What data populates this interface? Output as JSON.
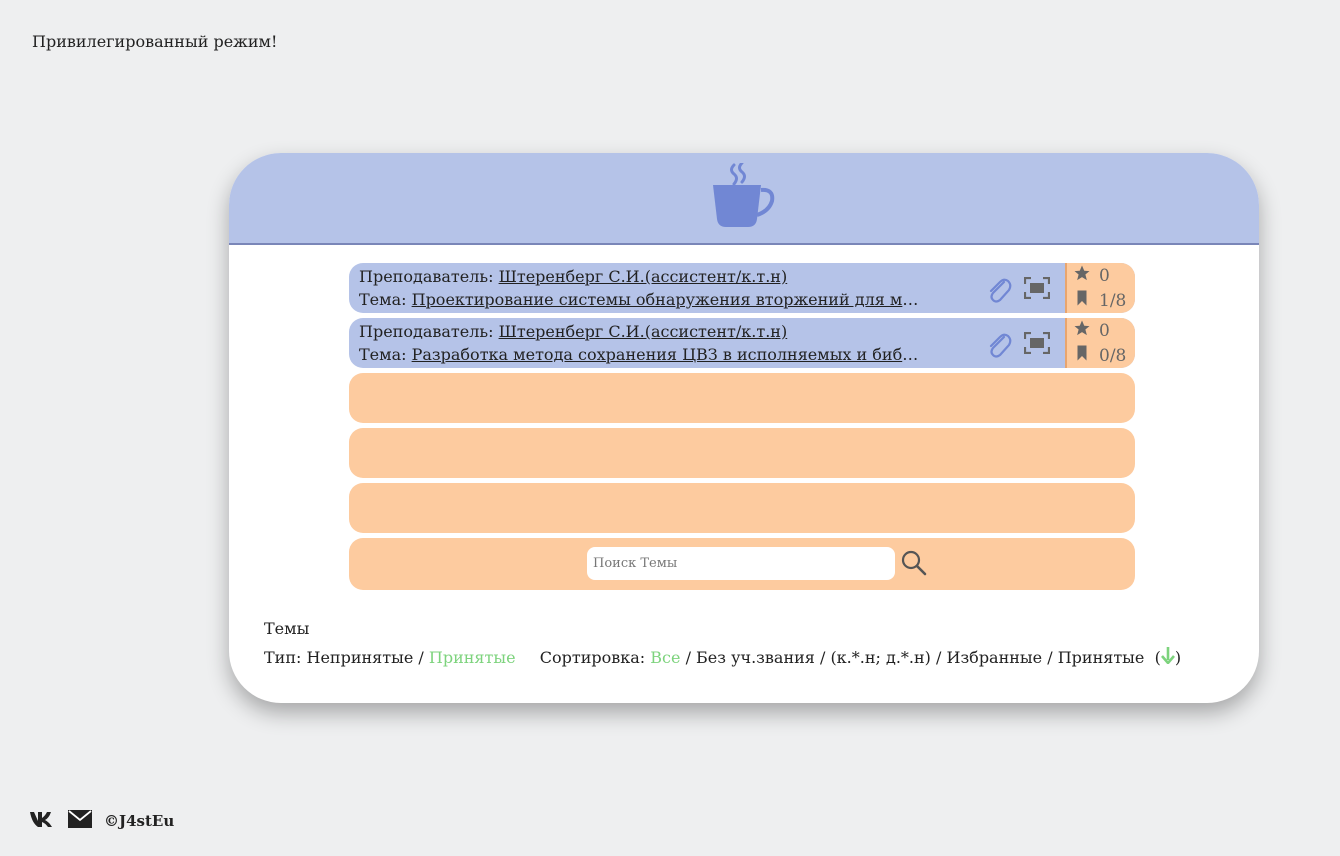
{
  "page": {
    "mode_text": "Привилегированный режим!"
  },
  "header": {
    "logo_icon": "coffee-cup-icon",
    "accent": "#7187d4"
  },
  "topics": [
    {
      "teacher_label": "Преподаватель:",
      "teacher": "Штеренберг С.И.(ассистент/к.т.н)",
      "topic_label": "Тема:",
      "topic": "Проектирование системы обнаружения вторжений для мо...",
      "stars": "0",
      "bookmarks": "1/8"
    },
    {
      "teacher_label": "Преподаватель:",
      "teacher": "Штеренберг С.И.(ассистент/к.т.н)",
      "topic_label": "Тема:",
      "topic": "Разработка метода сохранения ЦВЗ в исполняемых и библ...",
      "stars": "0",
      "bookmarks": "0/8"
    }
  ],
  "search": {
    "placeholder": "Поиск Темы"
  },
  "section": {
    "title": "Темы"
  },
  "filters": {
    "type_label": "Тип:",
    "type_unaccepted": "Непринятые",
    "type_accepted": "Принятые",
    "sort_label": "Сортировка:",
    "sort_all": "Все",
    "sort_no_degree": "Без уч.звания",
    "sort_degree": "(к.*.н; д.*.н)",
    "sort_favorites": "Избранные",
    "sort_accepted": "Принятые",
    "sep": "/",
    "paren_open": "(",
    "paren_close": ")"
  },
  "footer": {
    "copyright": "©J4stEu"
  },
  "colors": {
    "blue": "#b5c3e8",
    "peach": "#fdcb9f",
    "green": "#7dd37d",
    "icon_gray": "#666666"
  }
}
